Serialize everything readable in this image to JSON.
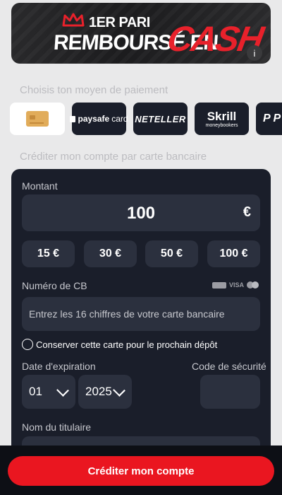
{
  "banner": {
    "line1": "1ER PARI",
    "line2": "REMBOURSÉ EN",
    "highlight": "CASH",
    "info_label": "i"
  },
  "payment": {
    "section_label": "Choisis ton moyen de paiement",
    "methods": [
      {
        "name": "card",
        "icon": "credit-card-icon",
        "active": true
      },
      {
        "name": "paysafecard",
        "label_bold": "paysafe",
        "label_light": "card"
      },
      {
        "name": "neteller",
        "label": "NETELLER"
      },
      {
        "name": "skrill",
        "label": "Skrill",
        "sub": "moneybookers"
      },
      {
        "name": "paypal",
        "label": "P P"
      }
    ]
  },
  "card_section": {
    "title": "Créditer mon compte par carte bancaire",
    "montant_label": "Montant",
    "amount": "100",
    "currency": "€",
    "quick_amounts": [
      "15 €",
      "30 €",
      "50 €",
      "100 €"
    ],
    "cb_label": "Numéro de CB",
    "card_brands": [
      "VISA"
    ],
    "cb_placeholder": "Entrez les 16 chiffres de votre carte bancaire",
    "save_card_label": "Conserver cette carte pour le prochain dépôt",
    "expiry_label": "Date d'expiration",
    "expiry_month": "01",
    "expiry_year": "2025",
    "cvv_label": "Code de sécurité",
    "holder_label": "Nom du titulaire"
  },
  "cta": {
    "label": "Créditer mon compte"
  },
  "colors": {
    "accent": "#ea1620",
    "panel": "#1a1e2a",
    "field": "#2b303e"
  }
}
